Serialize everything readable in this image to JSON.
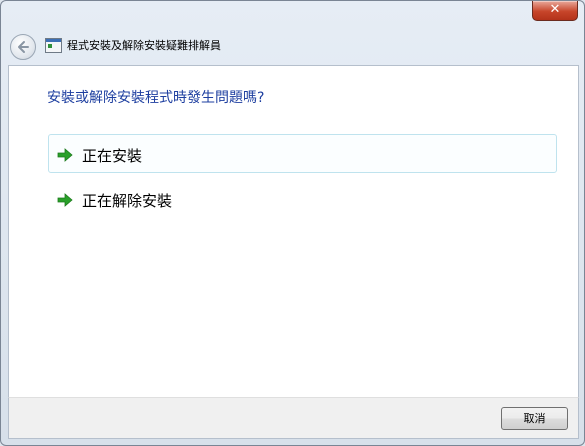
{
  "window": {
    "title": "程式安裝及解除安裝疑難排解員",
    "close_label": "✕"
  },
  "main": {
    "question": "安裝或解除安裝程式時發生問題嗎?",
    "options": [
      {
        "label": "正在安裝"
      },
      {
        "label": "正在解除安裝"
      }
    ]
  },
  "footer": {
    "cancel_label": "取消"
  },
  "colors": {
    "question_text": "#1e3fa0",
    "arrow_green": "#2aa02a",
    "hover_border": "#bfe3ee"
  }
}
